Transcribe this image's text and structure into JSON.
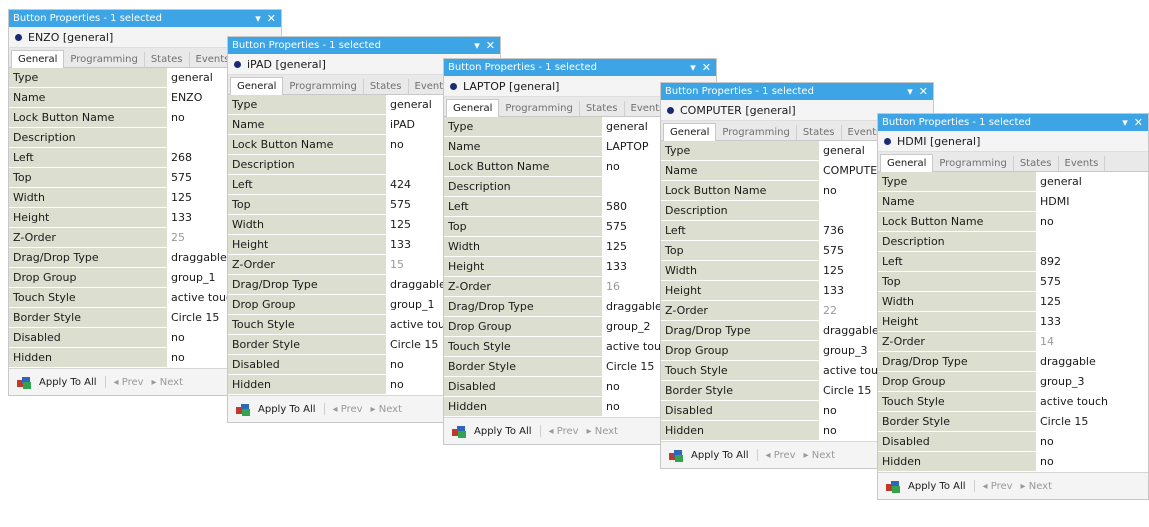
{
  "common": {
    "title": "Button Properties - 1 selected",
    "tabs": [
      "General",
      "Programming",
      "States",
      "Events"
    ],
    "footer": {
      "apply": "Apply To All",
      "prev": "◂ Prev",
      "next": "▸ Next"
    },
    "labels": [
      "Type",
      "Name",
      "Lock Button Name",
      "Description",
      "Left",
      "Top",
      "Width",
      "Height",
      "Z-Order",
      "Drag/Drop Type",
      "Drop Group",
      "Touch Style",
      "Border Style",
      "Disabled",
      "Hidden"
    ]
  },
  "panels": [
    {
      "object": "ENZO  [general]",
      "values": [
        "general",
        "ENZO",
        "no",
        "",
        "268",
        "575",
        "125",
        "133",
        "25",
        "draggable",
        "group_1",
        "active touch",
        "Circle 15",
        "no",
        "no"
      ]
    },
    {
      "object": "iPAD  [general]",
      "values": [
        "general",
        "iPAD",
        "no",
        "",
        "424",
        "575",
        "125",
        "133",
        "15",
        "draggable",
        "group_1",
        "active touch",
        "Circle 15",
        "no",
        "no"
      ]
    },
    {
      "object": "LAPTOP  [general]",
      "values": [
        "general",
        "LAPTOP",
        "no",
        "",
        "580",
        "575",
        "125",
        "133",
        "16",
        "draggable",
        "group_2",
        "active touch",
        "Circle 15",
        "no",
        "no"
      ]
    },
    {
      "object": "COMPUTER  [general]",
      "values": [
        "general",
        "COMPUTER",
        "no",
        "",
        "736",
        "575",
        "125",
        "133",
        "22",
        "draggable",
        "group_3",
        "active touch",
        "Circle 15",
        "no",
        "no"
      ]
    },
    {
      "object": "HDMI  [general]",
      "values": [
        "general",
        "HDMI",
        "no",
        "",
        "892",
        "575",
        "125",
        "133",
        "14",
        "draggable",
        "group_3",
        "active touch",
        "Circle 15",
        "no",
        "no"
      ]
    }
  ]
}
